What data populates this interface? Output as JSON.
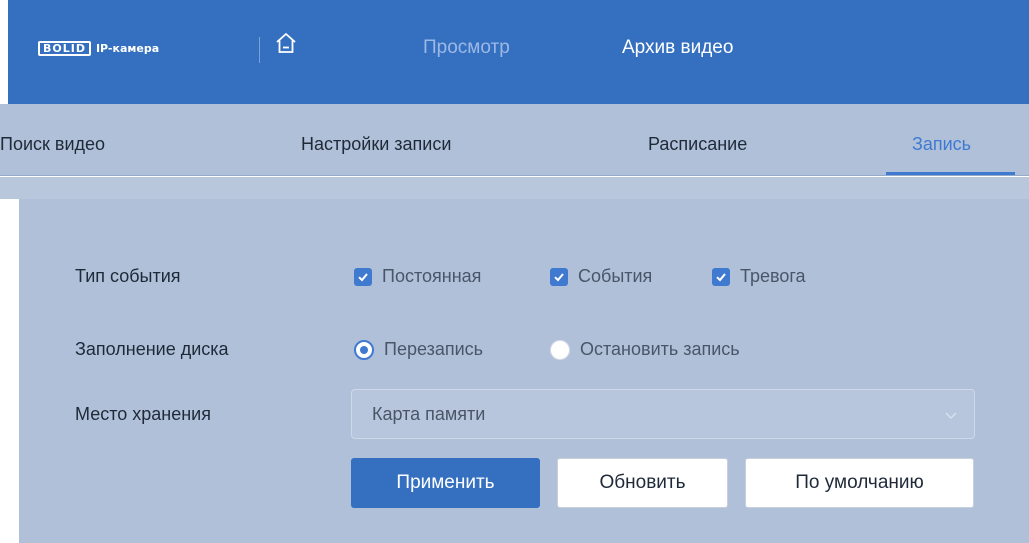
{
  "header": {
    "logo_mark": "BOLID",
    "logo_text": "IP-камера",
    "nav": {
      "view": "Просмотр",
      "archive": "Архив видео"
    }
  },
  "tabs": {
    "search": "Поиск видео",
    "settings": "Настройки записи",
    "schedule": "Расписание",
    "record": "Запись"
  },
  "form": {
    "event_type": {
      "label": "Тип события",
      "options": [
        {
          "label": "Постоянная",
          "checked": true
        },
        {
          "label": "События",
          "checked": true
        },
        {
          "label": "Тревога",
          "checked": true
        }
      ]
    },
    "disk_full": {
      "label": "Заполнение диска",
      "options": [
        {
          "label": "Перезапись",
          "selected": true
        },
        {
          "label": "Остановить запись",
          "selected": false
        }
      ]
    },
    "storage": {
      "label": "Место хранения",
      "value": "Карта памяти"
    }
  },
  "buttons": {
    "apply": "Применить",
    "refresh": "Обновить",
    "default": "По умолчанию"
  },
  "colors": {
    "header_bg": "#3570c0",
    "accent": "#3f7ad0",
    "panel_bg": "#b0c0d9"
  },
  "icons": {
    "home": "home-icon",
    "check": "check-icon",
    "chevron": "chevron-down-icon"
  }
}
